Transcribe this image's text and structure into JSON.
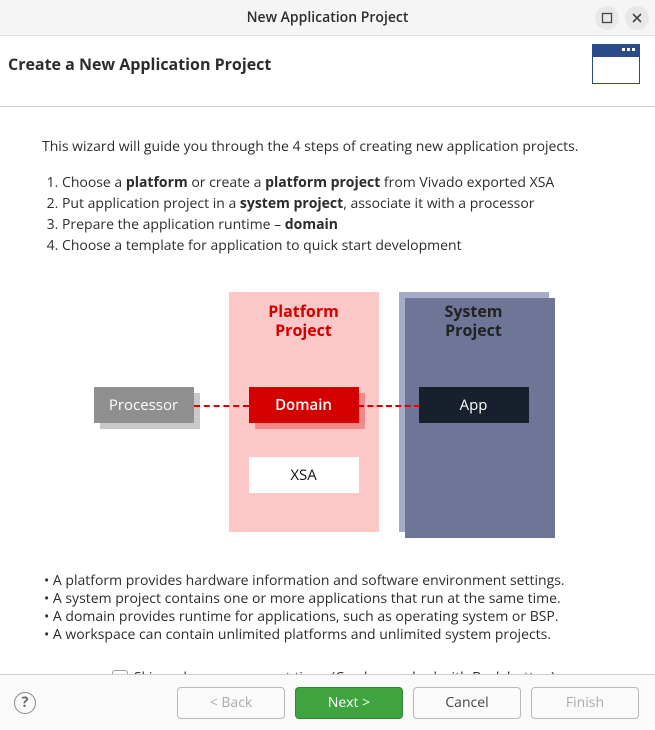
{
  "window": {
    "title": "New Application Project"
  },
  "header": {
    "title": "Create a New Application Project"
  },
  "intro": "This wizard will guide you through the 4 steps of creating new application projects.",
  "steps": {
    "s1a": "Choose a ",
    "s1b": "platform",
    "s1c": " or create a ",
    "s1d": "platform project",
    "s1e": " from Vivado exported XSA",
    "s2a": "Put application project in a ",
    "s2b": "system project",
    "s2c": ", associate it with a processor",
    "s3a": "Prepare the application runtime – ",
    "s3b": "domain",
    "s4": "Choose a template for application to quick start development"
  },
  "diagram": {
    "processor": "Processor",
    "platform_title_l1": "Platform",
    "platform_title_l2": "Project",
    "domain": "Domain",
    "xsa": "XSA",
    "system_title_l1": "System",
    "system_title_l2": "Project",
    "app": "App"
  },
  "bullets": {
    "b1": "• A platform provides hardware information and software environment settings.",
    "b2": "• A system project contains one or more applications that run at the same time.",
    "b3": "• A domain provides runtime for applications, such as operating system or BSP.",
    "b4": "• A workspace can contain unlimited platforms and unlimited system projects."
  },
  "skip": {
    "label": "Skip welcome page next time. (Can be reached with Back button)"
  },
  "buttons": {
    "help": "?",
    "back": "< Back",
    "next": "Next >",
    "cancel": "Cancel",
    "finish": "Finish"
  }
}
